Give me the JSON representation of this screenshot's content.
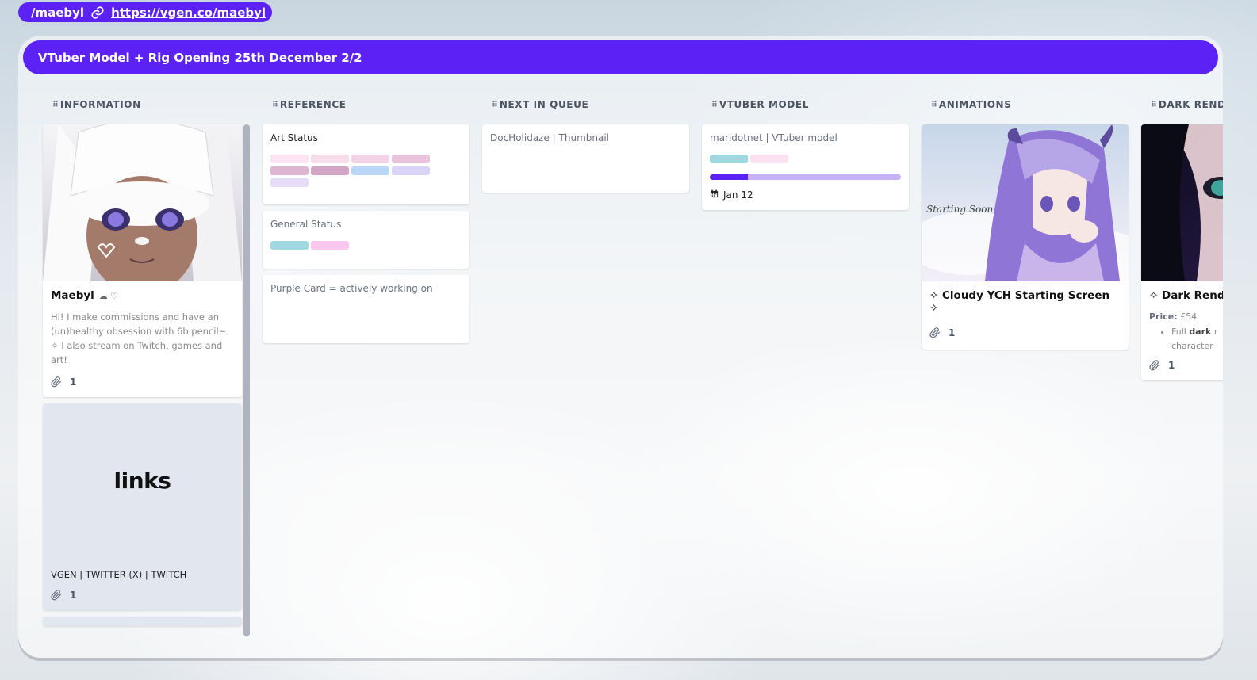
{
  "topbar": {
    "username": "/maebyl",
    "url": "https://vgen.co/maebyl"
  },
  "board": {
    "title": "VTuber Model + Rig Opening 25th December 2/2"
  },
  "columns": {
    "information": {
      "title": "INFORMATION",
      "profile_card": {
        "name": "Maebyl",
        "name_suffix": "☁ ♡",
        "description": "Hi! I make commissions and have an (un)healthy obsession with 6b pencil~ ✧ I also stream on Twitch, games and art!",
        "attachments": "1"
      },
      "links_card": {
        "cover_text": "links",
        "title": "VGEN | TWITTER (X) | TWITCH",
        "attachments": "1"
      }
    },
    "reference": {
      "title": "REFERENCE",
      "cards": [
        {
          "title": "Art Status",
          "labels": [
            "#fde4f2",
            "#f7dcea",
            "#f4d3e6",
            "#e9c3dc",
            "#dfb6d2",
            "#d3a5c7",
            "#bcd6f7",
            "#d9d3f7",
            "#e6dcf8"
          ]
        },
        {
          "title": "General Status",
          "labels": [
            "#9fd8e1",
            "#fac8ef"
          ]
        },
        {
          "title": "Purple Card = actively working on"
        }
      ]
    },
    "next_in_queue": {
      "title": "NEXT IN QUEUE",
      "cards": [
        {
          "title": "DocHolidaze | Thumbnail"
        }
      ]
    },
    "vtuber_model": {
      "title": "VTUBER MODEL",
      "cards": [
        {
          "title": "maridotnet | VTuber model",
          "labels": [
            "#9fd8e1",
            "#fbe1f1"
          ],
          "progress": 0.2,
          "due": "Jan 12"
        }
      ]
    },
    "animations": {
      "title": "ANIMATIONS",
      "cards": [
        {
          "title": "✧ Cloudy YCH Starting Screen ✧",
          "attachments": "1",
          "cover_text": "Starting Soon"
        }
      ]
    },
    "dark_render": {
      "title": "DARK RENDER",
      "cards": [
        {
          "title": "✧ Dark Render",
          "price_label": "Price:",
          "price": "£54",
          "bullet_prefix": "Full ",
          "bullet_bold": "dark",
          "bullet_rest": " r",
          "bullet_line2": "character",
          "attachments": "1"
        }
      ]
    }
  },
  "colors": {
    "accent": "#5b21f5"
  }
}
